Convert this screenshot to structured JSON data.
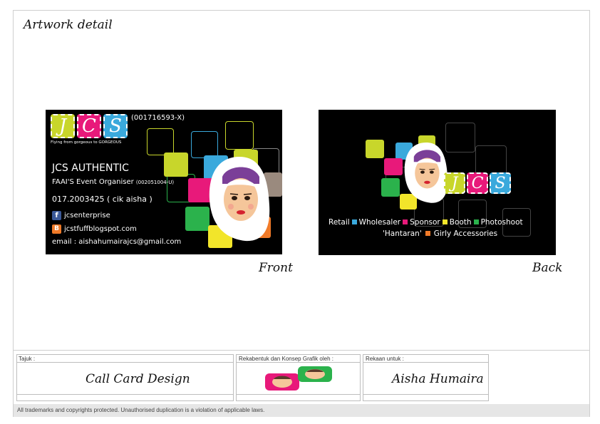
{
  "sheet": {
    "title": "Artwork detail",
    "front_label": "Front",
    "back_label": "Back"
  },
  "front_card": {
    "logo_letters": [
      "J",
      "C",
      "S"
    ],
    "registration": "(001716593-X)",
    "tagline": "Flying from gorgeous to GORGEOUS",
    "company": "JCS AUTHENTIC",
    "role": "FAAI'S Event Organiser",
    "role_reg": "(002051004-U)",
    "phone": "017.2003425 ( cik aisha )",
    "facebook": "jcsenterprise",
    "blog": "jcstfuffblogspot.com",
    "email": "email : aishahumairajcs@gmail.com"
  },
  "back_card": {
    "logo_letters": [
      "J",
      "C",
      "S"
    ],
    "services_line1": [
      "Retail",
      "Wholesaler",
      "Sponsor",
      "Booth",
      "Photoshoot"
    ],
    "services_line2": [
      "'Hantaran'",
      "Girly Accessories"
    ]
  },
  "title_block": {
    "tajuk_label": "Tajuk :",
    "tajuk_value": "Call Card Design",
    "design_label": "Rekabentuk dan Konsep Grafik oleh  :",
    "client_label": "Rekaan untuk :",
    "client_value": "Aisha Humaira"
  },
  "copyright": "All trademarks and copyrights protected. Unauthorised duplication is a violation of applicable laws.",
  "colors": {
    "lime": "#c8d62b",
    "pink": "#e8197a",
    "cyan": "#3aa9dc",
    "green": "#2bb24c",
    "orange": "#f07a28",
    "yellow": "#f2e52a",
    "taupe": "#9a8a7e",
    "card_bg": "#000000"
  }
}
